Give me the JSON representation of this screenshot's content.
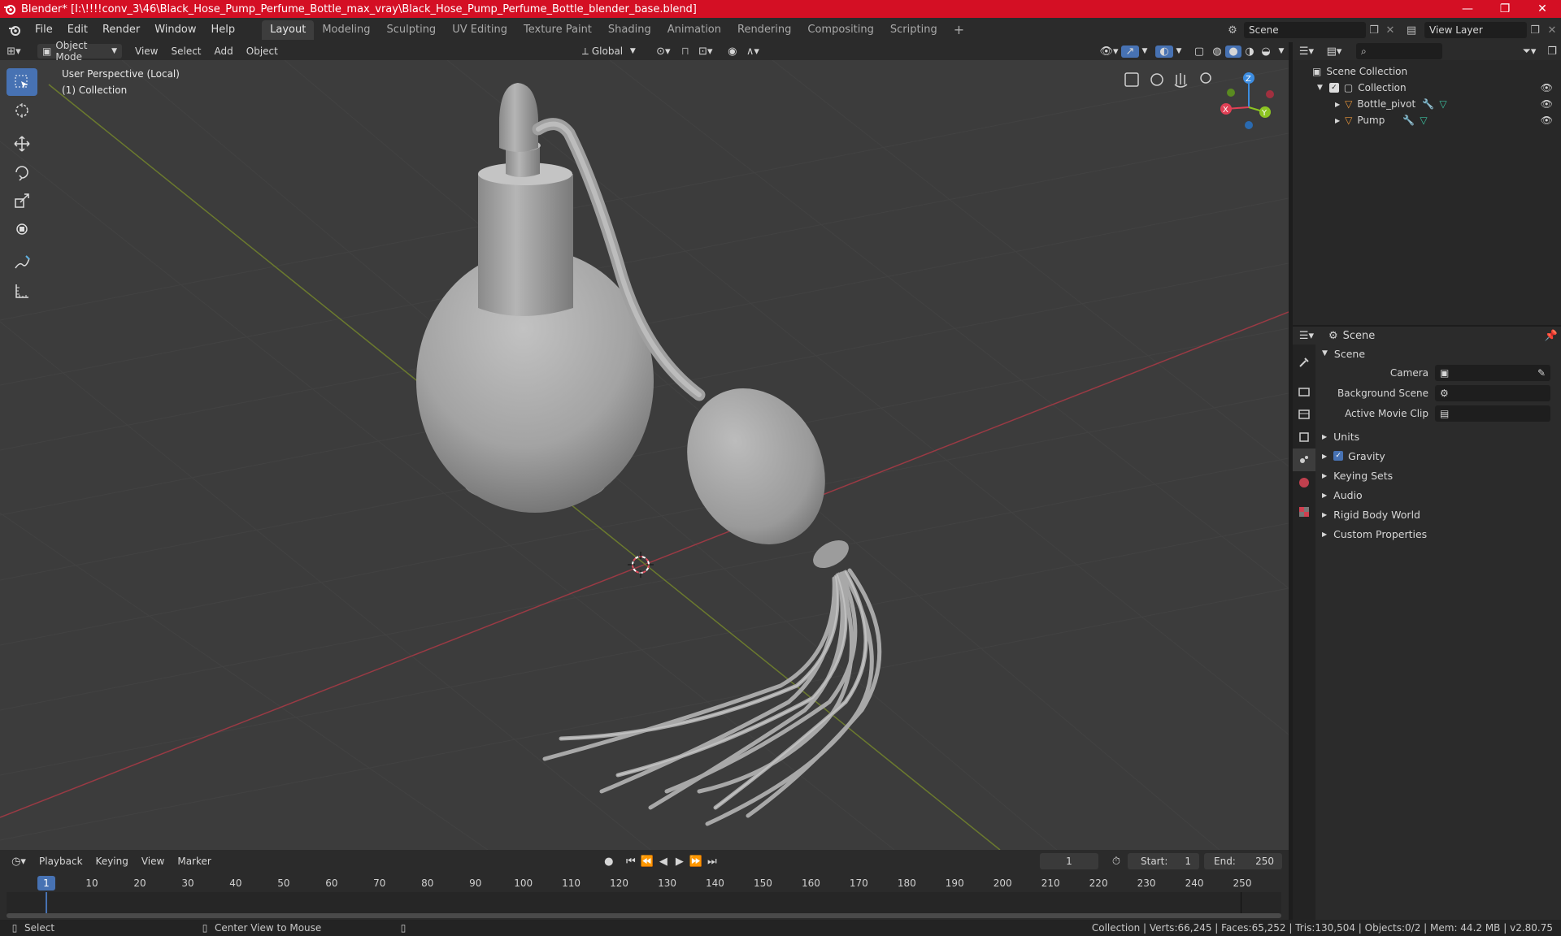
{
  "window": {
    "title": "Blender* [I:\\!!!!conv_3\\46\\Black_Hose_Pump_Perfume_Bottle_max_vray\\Black_Hose_Pump_Perfume_Bottle_blender_base.blend]",
    "minimize": "—",
    "maximize": "❐",
    "close": "✕"
  },
  "menu": {
    "items": [
      "File",
      "Edit",
      "Render",
      "Window",
      "Help"
    ],
    "workspaces": [
      "Layout",
      "Modeling",
      "Sculpting",
      "UV Editing",
      "Texture Paint",
      "Shading",
      "Animation",
      "Rendering",
      "Compositing",
      "Scripting"
    ],
    "add_tab": "+",
    "scene": "Scene",
    "view_layer": "View Layer"
  },
  "viewport": {
    "mode": "Object Mode",
    "menus": [
      "View",
      "Select",
      "Add",
      "Object"
    ],
    "orientation": "Global",
    "overlay_line1": "User Perspective (Local)",
    "overlay_line2": "(1) Collection",
    "gizmo": {
      "x": "X",
      "y": "Y",
      "z": "Z"
    }
  },
  "outliner": {
    "root": "Scene Collection",
    "collection": "Collection",
    "objects": [
      "Bottle_pivot",
      "Pump"
    ]
  },
  "properties": {
    "context": "Scene",
    "panel": "Scene",
    "fields": [
      {
        "label": "Camera",
        "value": ""
      },
      {
        "label": "Background Scene",
        "value": ""
      },
      {
        "label": "Active Movie Clip",
        "value": ""
      }
    ],
    "sections": [
      "Units",
      "Gravity",
      "Keying Sets",
      "Audio",
      "Rigid Body World",
      "Custom Properties"
    ],
    "gravity_checked": true
  },
  "timeline": {
    "menus": [
      "Playback",
      "Keying",
      "View",
      "Marker"
    ],
    "current_frame": "1",
    "start_label": "Start:",
    "start": "1",
    "end_label": "End:",
    "end": "250",
    "ticks": [
      "1",
      "10",
      "20",
      "30",
      "40",
      "50",
      "60",
      "70",
      "80",
      "90",
      "100",
      "110",
      "120",
      "130",
      "140",
      "150",
      "160",
      "170",
      "180",
      "190",
      "200",
      "210",
      "220",
      "230",
      "240",
      "250"
    ]
  },
  "status": {
    "left_action": "Select",
    "middle_action": "Center View to Mouse",
    "stats": "Collection | Verts:66,245 | Faces:65,252 | Tris:130,504 | Objects:0/2 | Mem: 44.2 MB | v2.80.75"
  },
  "colors": {
    "titlebar": "#d40f24",
    "active_tool": "#4772b3",
    "axis_x": "#e04055",
    "axis_y": "#8cc422",
    "axis_z": "#3c8ce0"
  }
}
